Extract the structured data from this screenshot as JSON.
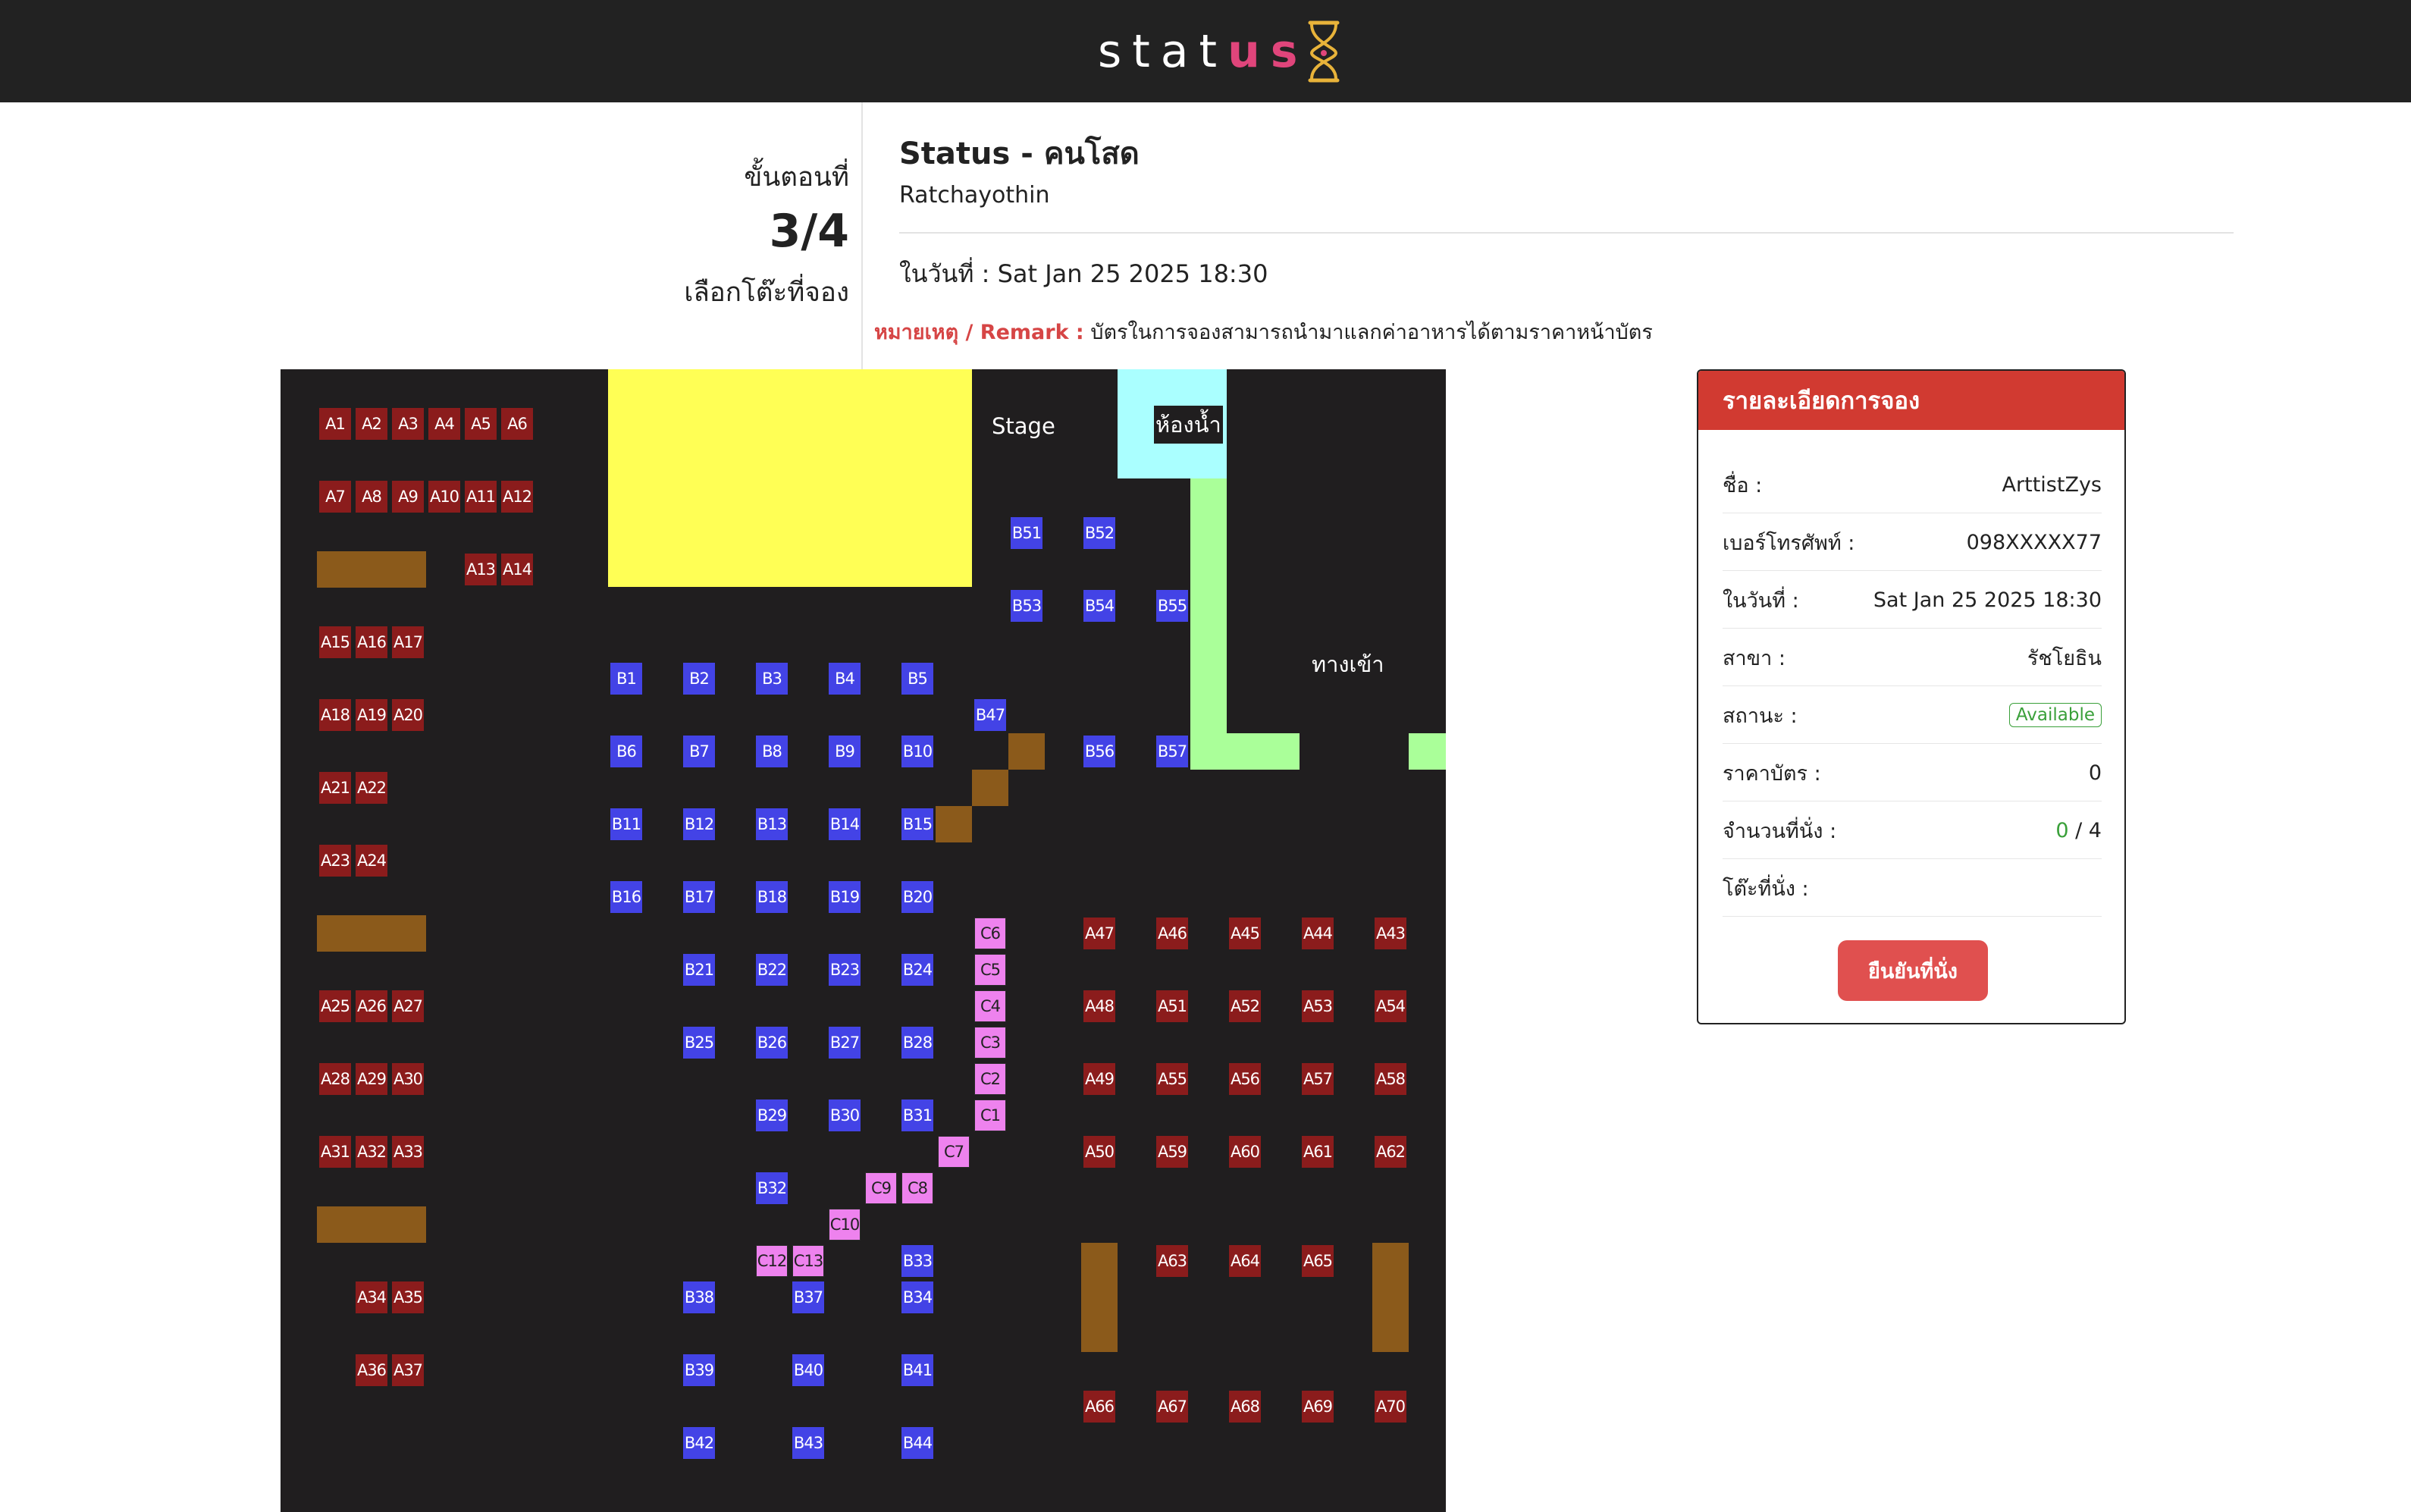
{
  "header": {
    "logo_prefix": "stat",
    "logo_accent": "us",
    "logo_icon": "hourglass-icon",
    "colors": {
      "bar": "#222222",
      "accent": "#e0457b",
      "logo_gold": "#e8b33a"
    }
  },
  "step": {
    "label": "ขั้นตอนที่",
    "number": "3/4",
    "description": "เลือกโต๊ะที่จอง"
  },
  "event": {
    "title": "Status - คนโสด",
    "branch": "Ratchayothin",
    "date_line": "ในวันที่ : Sat Jan 25 2025 18:30",
    "remark_label": "หมายเหตุ / Remark :",
    "remark_text": " บัตรในการจองสามารถนำมาแลกค่าอาหารได้ตามราคาหน้าบัตร"
  },
  "map": {
    "stage_label": "Stage",
    "restroom_label": "ห้องน้ำ",
    "entrance_label": "ทางเข้า",
    "colors": {
      "a_zone": "#8b1c1c",
      "b_zone": "#4343e6",
      "c_zone": "#ee82ee",
      "stage": "#ffff55",
      "restroom": "#aaffff",
      "walkway": "#aaff99",
      "obstacle": "#8b5a1b",
      "floor": "#201e1f"
    },
    "seats": [
      {
        "id": "A1",
        "z": "a"
      },
      {
        "id": "A2",
        "z": "a"
      },
      {
        "id": "A3",
        "z": "a"
      },
      {
        "id": "A4",
        "z": "a"
      },
      {
        "id": "A5",
        "z": "a"
      },
      {
        "id": "A6",
        "z": "a"
      },
      {
        "id": "A7",
        "z": "a"
      },
      {
        "id": "A8",
        "z": "a"
      },
      {
        "id": "A9",
        "z": "a"
      },
      {
        "id": "A10",
        "z": "a"
      },
      {
        "id": "A11",
        "z": "a"
      },
      {
        "id": "A12",
        "z": "a"
      },
      {
        "id": "A13",
        "z": "a"
      },
      {
        "id": "A14",
        "z": "a"
      },
      {
        "id": "A15",
        "z": "a"
      },
      {
        "id": "A16",
        "z": "a"
      },
      {
        "id": "A17",
        "z": "a"
      },
      {
        "id": "A18",
        "z": "a"
      },
      {
        "id": "A19",
        "z": "a"
      },
      {
        "id": "A20",
        "z": "a"
      },
      {
        "id": "A21",
        "z": "a"
      },
      {
        "id": "A22",
        "z": "a"
      },
      {
        "id": "A23",
        "z": "a"
      },
      {
        "id": "A24",
        "z": "a"
      },
      {
        "id": "A25",
        "z": "a"
      },
      {
        "id": "A26",
        "z": "a"
      },
      {
        "id": "A27",
        "z": "a"
      },
      {
        "id": "A28",
        "z": "a"
      },
      {
        "id": "A29",
        "z": "a"
      },
      {
        "id": "A30",
        "z": "a"
      },
      {
        "id": "A31",
        "z": "a"
      },
      {
        "id": "A32",
        "z": "a"
      },
      {
        "id": "A33",
        "z": "a"
      },
      {
        "id": "A34",
        "z": "a"
      },
      {
        "id": "A35",
        "z": "a"
      },
      {
        "id": "A36",
        "z": "a"
      },
      {
        "id": "A37",
        "z": "a"
      },
      {
        "id": "A47",
        "z": "a"
      },
      {
        "id": "A46",
        "z": "a"
      },
      {
        "id": "A45",
        "z": "a"
      },
      {
        "id": "A44",
        "z": "a"
      },
      {
        "id": "A43",
        "z": "a"
      },
      {
        "id": "A48",
        "z": "a"
      },
      {
        "id": "A51",
        "z": "a"
      },
      {
        "id": "A52",
        "z": "a"
      },
      {
        "id": "A53",
        "z": "a"
      },
      {
        "id": "A54",
        "z": "a"
      },
      {
        "id": "A49",
        "z": "a"
      },
      {
        "id": "A55",
        "z": "a"
      },
      {
        "id": "A56",
        "z": "a"
      },
      {
        "id": "A57",
        "z": "a"
      },
      {
        "id": "A58",
        "z": "a"
      },
      {
        "id": "A50",
        "z": "a"
      },
      {
        "id": "A59",
        "z": "a"
      },
      {
        "id": "A60",
        "z": "a"
      },
      {
        "id": "A61",
        "z": "a"
      },
      {
        "id": "A62",
        "z": "a"
      },
      {
        "id": "A63",
        "z": "a"
      },
      {
        "id": "A64",
        "z": "a"
      },
      {
        "id": "A65",
        "z": "a"
      },
      {
        "id": "A66",
        "z": "a"
      },
      {
        "id": "A67",
        "z": "a"
      },
      {
        "id": "A68",
        "z": "a"
      },
      {
        "id": "A69",
        "z": "a"
      },
      {
        "id": "A70",
        "z": "a"
      },
      {
        "id": "B1",
        "z": "b"
      },
      {
        "id": "B2",
        "z": "b"
      },
      {
        "id": "B3",
        "z": "b"
      },
      {
        "id": "B4",
        "z": "b"
      },
      {
        "id": "B5",
        "z": "b"
      },
      {
        "id": "B6",
        "z": "b"
      },
      {
        "id": "B7",
        "z": "b"
      },
      {
        "id": "B8",
        "z": "b"
      },
      {
        "id": "B9",
        "z": "b"
      },
      {
        "id": "B10",
        "z": "b"
      },
      {
        "id": "B11",
        "z": "b"
      },
      {
        "id": "B12",
        "z": "b"
      },
      {
        "id": "B13",
        "z": "b"
      },
      {
        "id": "B14",
        "z": "b"
      },
      {
        "id": "B15",
        "z": "b"
      },
      {
        "id": "B16",
        "z": "b"
      },
      {
        "id": "B17",
        "z": "b"
      },
      {
        "id": "B18",
        "z": "b"
      },
      {
        "id": "B19",
        "z": "b"
      },
      {
        "id": "B20",
        "z": "b"
      },
      {
        "id": "B21",
        "z": "b"
      },
      {
        "id": "B22",
        "z": "b"
      },
      {
        "id": "B23",
        "z": "b"
      },
      {
        "id": "B24",
        "z": "b"
      },
      {
        "id": "B25",
        "z": "b"
      },
      {
        "id": "B26",
        "z": "b"
      },
      {
        "id": "B27",
        "z": "b"
      },
      {
        "id": "B28",
        "z": "b"
      },
      {
        "id": "B29",
        "z": "b"
      },
      {
        "id": "B30",
        "z": "b"
      },
      {
        "id": "B31",
        "z": "b"
      },
      {
        "id": "B32",
        "z": "b"
      },
      {
        "id": "B33",
        "z": "b"
      },
      {
        "id": "B38",
        "z": "b"
      },
      {
        "id": "B37",
        "z": "b"
      },
      {
        "id": "B34",
        "z": "b"
      },
      {
        "id": "B39",
        "z": "b"
      },
      {
        "id": "B40",
        "z": "b"
      },
      {
        "id": "B41",
        "z": "b"
      },
      {
        "id": "B42",
        "z": "b"
      },
      {
        "id": "B43",
        "z": "b"
      },
      {
        "id": "B44",
        "z": "b"
      },
      {
        "id": "B47",
        "z": "b"
      },
      {
        "id": "B51",
        "z": "b"
      },
      {
        "id": "B52",
        "z": "b"
      },
      {
        "id": "B53",
        "z": "b"
      },
      {
        "id": "B54",
        "z": "b"
      },
      {
        "id": "B55",
        "z": "b"
      },
      {
        "id": "B56",
        "z": "b"
      },
      {
        "id": "B57",
        "z": "b"
      },
      {
        "id": "C1",
        "z": "c"
      },
      {
        "id": "C2",
        "z": "c"
      },
      {
        "id": "C3",
        "z": "c"
      },
      {
        "id": "C4",
        "z": "c"
      },
      {
        "id": "C5",
        "z": "c"
      },
      {
        "id": "C6",
        "z": "c"
      },
      {
        "id": "C7",
        "z": "c"
      },
      {
        "id": "C8",
        "z": "c"
      },
      {
        "id": "C9",
        "z": "c"
      },
      {
        "id": "C10",
        "z": "c"
      },
      {
        "id": "C12",
        "z": "c"
      },
      {
        "id": "C13",
        "z": "c"
      }
    ]
  },
  "booking": {
    "header": "รายละเอียดการจอง",
    "rows": [
      {
        "label": "ชื่อ :",
        "value": "ArttistZys"
      },
      {
        "label": "เบอร์โทรศัพท์ :",
        "value": "098XXXXX77"
      },
      {
        "label": "ในวันที่ :",
        "value": "Sat Jan 25 2025 18:30"
      },
      {
        "label": "สาขา :",
        "value": "รัชโยธิน"
      },
      {
        "label": "สถานะ :",
        "value": "Available"
      },
      {
        "label": "ราคาบัตร :",
        "value": "0"
      },
      {
        "label": "จำนวนที่นั่ง :",
        "value_selected": "0",
        "value_total": " / 4"
      },
      {
        "label": "โต๊ะที่นั่ง :",
        "value": ""
      }
    ],
    "confirm_label": "ยืนยันที่นั่ง",
    "colors": {
      "header": "#d13a31",
      "button": "#e0504f",
      "status": "#3aa03a"
    }
  }
}
